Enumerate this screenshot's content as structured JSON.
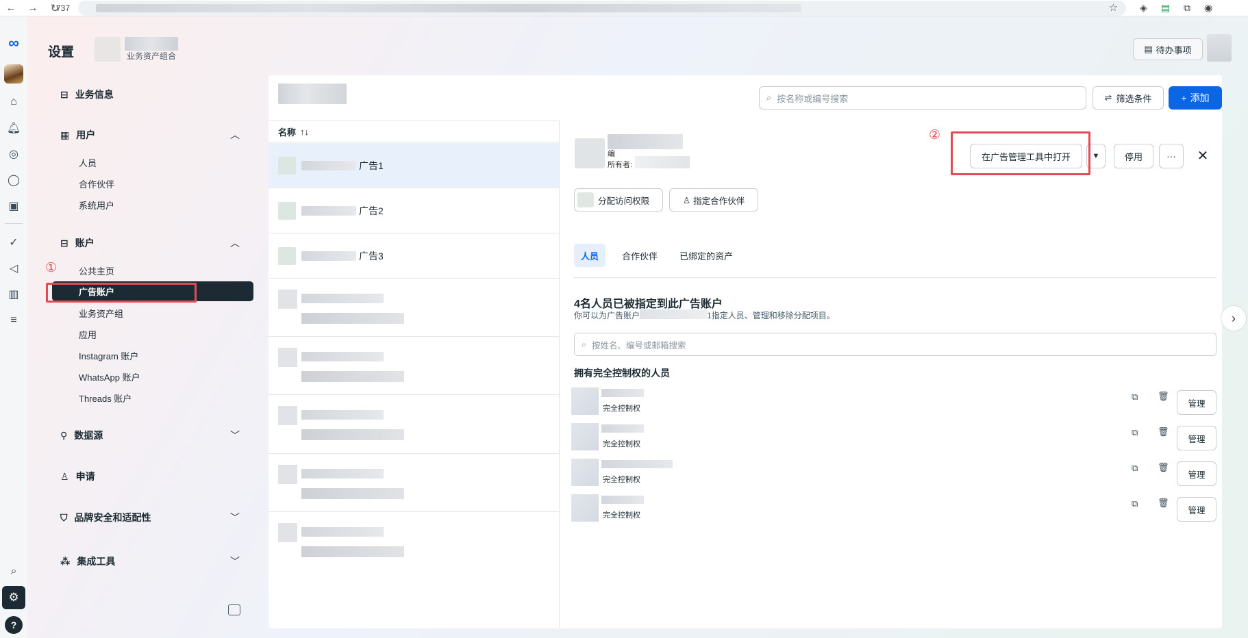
{
  "browser": {
    "reload_count": "737"
  },
  "header": {
    "title": "设置",
    "business_subtitle": "业务资产组合",
    "todo_label": "待办事项"
  },
  "sidebar": {
    "business_info": "业务信息",
    "users": {
      "label": "用户",
      "items": [
        "人员",
        "合作伙伴",
        "系统用户"
      ]
    },
    "accounts": {
      "label": "账户",
      "items": [
        "公共主页",
        "广告账户",
        "业务资产组",
        "应用",
        "Instagram 账户",
        "WhatsApp 账户",
        "Threads 账户"
      ],
      "active": "广告账户"
    },
    "data_sources": "数据源",
    "requests": "申请",
    "brand_safety": "品牌安全和适配性",
    "integrations": "集成工具"
  },
  "annotations": {
    "step1": "①",
    "step2": "②"
  },
  "toolbar": {
    "search_placeholder": "按名称或编号搜索",
    "filter_label": "筛选条件",
    "add_label": "添加"
  },
  "list": {
    "column_name": "名称",
    "sort_icon": "↑↓",
    "rows": [
      {
        "suffix": "广告1"
      },
      {
        "suffix": "广告2"
      },
      {
        "suffix": "广告3"
      }
    ]
  },
  "detail": {
    "id_prefix": "编",
    "owner_label": "所有者:",
    "open_in_ads_manager": "在广告管理工具中打开",
    "disable_label": "停用",
    "more_label": "···",
    "assign_access": "分配访问权限",
    "assign_partner": "指定合作伙伴",
    "tabs": [
      "人员",
      "合作伙伴",
      "已绑定的资产"
    ],
    "summary_title": "4名人员已被指定到此广告账户",
    "summary_sub_prefix": "你可以为广告账户",
    "summary_sub_suffix": "1指定人员、管理和移除分配项目。",
    "people_search_placeholder": "按姓名、编号或邮箱搜索",
    "full_control_title": "拥有完全控制权的人员",
    "people": [
      {
        "role": "完全控制权",
        "manage": "管理"
      },
      {
        "role": "完全控制权",
        "manage": "管理"
      },
      {
        "role": "完全控制权",
        "manage": "管理"
      },
      {
        "role": "完全控制权",
        "manage": "管理"
      }
    ]
  },
  "colors": {
    "accent": "#0a66e4",
    "annotation_red": "#e24b55",
    "dark": "#1c2b33"
  }
}
